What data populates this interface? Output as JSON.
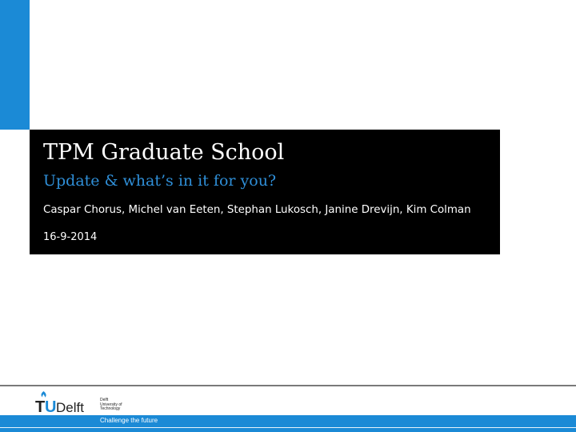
{
  "slide": {
    "title": "TPM Graduate School",
    "subtitle": "Update & what’s in it for you?",
    "authors": "Caspar Chorus, Michel van Eeten, Stephan Lukosch, Janine Drevijn, Kim Colman",
    "date": "16-9-2014"
  },
  "footer": {
    "logo_prefix": "T",
    "logo_u": "U",
    "logo_name": "Delft",
    "university_lines": [
      "Delft",
      "University of",
      "Technology"
    ],
    "tagline": "Challenge the future"
  },
  "colors": {
    "accent": "#1b8ad6",
    "subtitle": "#2f8fd8",
    "title_box": "#000000",
    "logo_text": "#222222"
  },
  "icons": {
    "logo_flame": "flame-icon"
  }
}
